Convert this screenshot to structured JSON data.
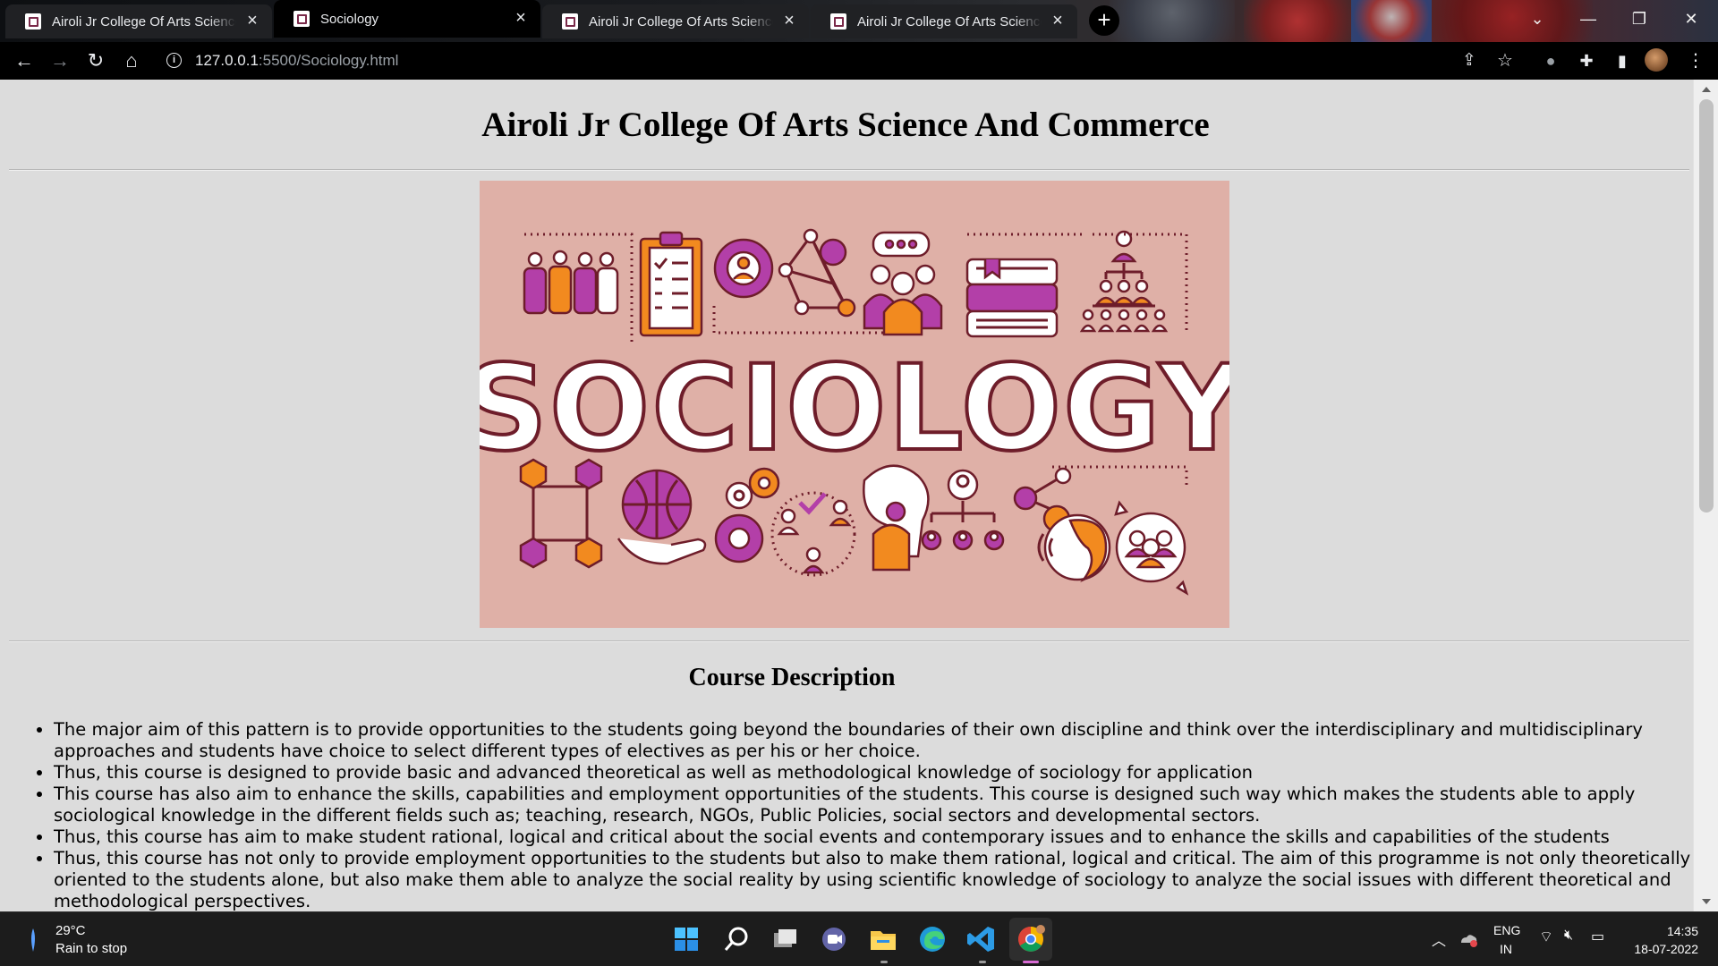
{
  "browser": {
    "tabs": [
      {
        "title": "Airoli Jr College Of Arts Science And Commerce",
        "active": false
      },
      {
        "title": "Sociology",
        "active": true
      },
      {
        "title": "Airoli Jr College Of Arts Science And Commerce",
        "active": false
      },
      {
        "title": "Airoli Jr College Of Arts Science And Commerce",
        "active": false
      }
    ],
    "new_tab_label": "+",
    "address": {
      "host": "127.0.0.1",
      "path": ":5500/Sociology.html"
    }
  },
  "page": {
    "title": "Airoli Jr College Of Arts Science And Commerce",
    "banner": {
      "word": "SOCIOLOGY",
      "background": "#dfb0a7",
      "accent_purple": "#b33fa8",
      "accent_orange": "#f28a1f",
      "outline": "#6e1d2a"
    },
    "course": {
      "heading": "Course Description",
      "items": [
        "The major aim of this pattern is to provide opportunities to the students going beyond the boundaries of their own discipline and think over the interdisciplinary and multidisciplinary approaches and students have choice to select different types of electives as per his or her choice.",
        "Thus, this course is designed to provide basic and advanced theoretical as well as methodological knowledge of sociology for application",
        "This course has also aim to enhance the skills, capabilities and employment opportunities of the students. This course is designed such way which makes the students able to apply sociological knowledge in the different fields such as; teaching, research, NGOs, Public Policies, social sectors and developmental sectors.",
        "Thus, this course has aim to make student rational, logical and critical about the social events and contemporary issues and to enhance the skills and capabilities of the students",
        "Thus, this course has not only to provide employment opportunities to the students but also to make them rational, logical and critical. The aim of this programme is not only theoretically oriented to the students alone, but also make them able to analyze the social reality by using scientific knowledge of sociology to analyze the social issues with different theoretical and methodological perspectives."
      ]
    }
  },
  "taskbar": {
    "weather": {
      "temp": "29°C",
      "desc": "Rain to stop"
    },
    "language": {
      "line1": "ENG",
      "line2": "IN"
    },
    "clock": {
      "time": "14:35",
      "date": "18-07-2022"
    },
    "apps": [
      "start-icon",
      "search-icon",
      "task-view-icon",
      "chat-icon",
      "file-explorer-icon",
      "edge-icon",
      "vscode-icon",
      "chrome-icon"
    ]
  }
}
